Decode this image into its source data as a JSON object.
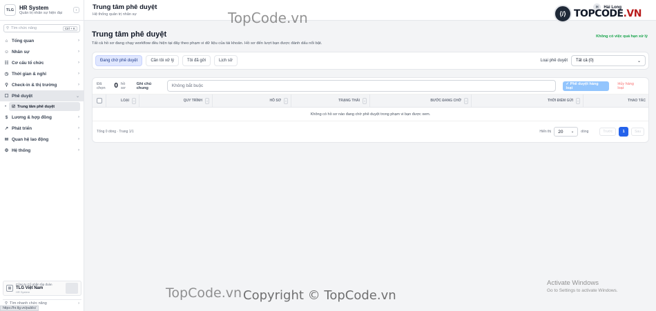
{
  "app": {
    "logo_text": "TLG",
    "title": "HR System",
    "subtitle": "Quản trị nhân sự hiện đại",
    "collapse_icon": "‹"
  },
  "sidebar": {
    "search_placeholder": "Tìm chức năng",
    "search_shortcut": "Ctrl + K",
    "items": [
      {
        "label": "Tổng quan",
        "icon": "⌂"
      },
      {
        "label": "Nhân sự",
        "icon": "☺"
      },
      {
        "label": "Cơ cấu tổ chức",
        "icon": "☷"
      },
      {
        "label": "Thời gian & nghỉ",
        "icon": "◷"
      },
      {
        "label": "Check-in & thị trường",
        "icon": "⚲"
      },
      {
        "label": "Phê duyệt",
        "icon": "☐"
      }
    ],
    "sub_item": {
      "label": "Trung tâm phê duyệt",
      "icon": "☑",
      "bullet": "•"
    },
    "items_after": [
      {
        "label": "Lương & hợp đồng",
        "icon": "$"
      },
      {
        "label": "Phát triển",
        "icon": "↗"
      },
      {
        "label": "Quan hệ lao động",
        "icon": "✉"
      },
      {
        "label": "Hệ thống",
        "icon": "⚙"
      }
    ],
    "company": {
      "line1": "Công ty Cổ phần tập đoàn",
      "name": "TLG Việt Nam",
      "sub": "HR System"
    },
    "quick_label": "Tìm nhanh chức năng",
    "status_url": "https://hr.tlg.vn/public/"
  },
  "header": {
    "title": "Trung tâm phê duyệt",
    "subtitle": "Hệ thống quản trị nhân sự",
    "user_initial": "H",
    "user_name": "Hải Long"
  },
  "page": {
    "title": "Trung tâm phê duyệt",
    "description": "Tất cả hồ sơ đang chạy workflow đều hiện tại đây theo phạm vi dữ liệu của tài khoản. Hồ sơ đến lượt bạn được đánh dấu nổi bật.",
    "deadline_note": "Không có việc quá hạn xử lý"
  },
  "tabs": [
    {
      "label": "Đang chờ phê duyệt",
      "active": true
    },
    {
      "label": "Cần tôi xử lý"
    },
    {
      "label": "Tôi đã gửi"
    },
    {
      "label": "Lịch sử"
    }
  ],
  "filter": {
    "label": "Loại phê duyệt",
    "value": "Tất cả (0)"
  },
  "actions": {
    "selected_prefix": "Đã chọn",
    "selected_count": "0",
    "selected_suffix": "hồ sơ",
    "note_label": "Ghi chú chung",
    "note_placeholder": "Không bắt buộc",
    "approve_label": "✓ Phê duyệt hàng loạt",
    "reject_label": "Hủy hàng loạt"
  },
  "table": {
    "columns": [
      "LOẠI",
      "QUY TRÌNH",
      "HỒ SƠ",
      "TRẠNG THÁI",
      "BƯỚC ĐANG CHỜ",
      "THỜI ĐIỂM GỬI",
      "THAO TÁC"
    ],
    "empty_message": "Không có hồ sơ nào đang chờ phê duyệt trong phạm vi bạn được xem."
  },
  "pagination": {
    "summary": "Tổng 0 dòng · Trang 1/1",
    "show_label": "Hiển thị",
    "page_size": "20",
    "rows_label": "dòng",
    "prev_label": "Trước",
    "current_page": "1",
    "next_label": "Sau"
  },
  "watermarks": {
    "topcode_top": "TopCode.vn",
    "topcode_bottom": "TopCode.vn",
    "copyright": "Copyright © TopCode.vn",
    "logo_text_black": "TOPCODE",
    "logo_text_red": ".VN"
  },
  "os": {
    "activate_title": "Activate Windows",
    "activate_sub": "Go to Settings to activate Windows."
  }
}
